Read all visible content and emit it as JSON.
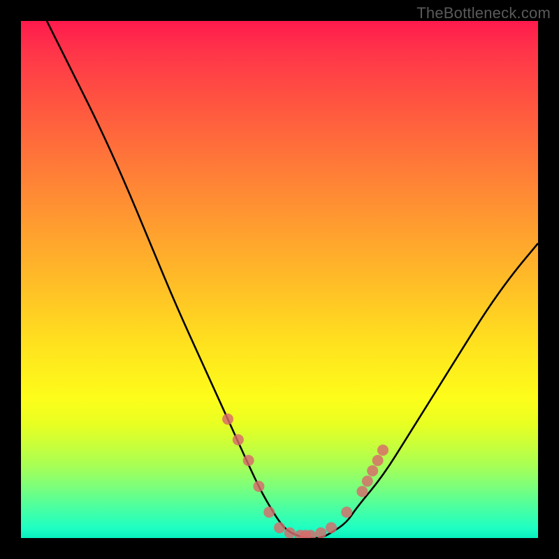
{
  "watermark": {
    "text": "TheBottleneck.com"
  },
  "colors": {
    "background": "#000000",
    "curve_stroke": "#000000",
    "marker_fill": "#d86a6a",
    "bottom_accent": "#08f0c0"
  },
  "chart_data": {
    "type": "line",
    "title": "",
    "xlabel": "",
    "ylabel": "",
    "xlim": [
      0,
      100
    ],
    "ylim": [
      0,
      100
    ],
    "grid": false,
    "legend": false,
    "series": [
      {
        "name": "bottleneck-curve",
        "x": [
          5,
          10,
          15,
          20,
          25,
          30,
          35,
          40,
          45,
          47,
          50,
          52,
          55,
          58,
          60,
          63,
          65,
          70,
          75,
          80,
          85,
          90,
          95,
          100
        ],
        "y": [
          100,
          90,
          80,
          69,
          57,
          45,
          34,
          23,
          12,
          8,
          3,
          1,
          0,
          0,
          1,
          3,
          6,
          12,
          20,
          28,
          36,
          44,
          51,
          57
        ]
      }
    ],
    "markers": {
      "name": "highlight-dots",
      "x": [
        40,
        42,
        44,
        46,
        48,
        50,
        52,
        54,
        55,
        56,
        58,
        60,
        63,
        66,
        67,
        68,
        69,
        70
      ],
      "y": [
        23,
        19,
        15,
        10,
        5,
        2,
        1,
        0.5,
        0.5,
        0.5,
        1,
        2,
        5,
        9,
        11,
        13,
        15,
        17
      ]
    }
  }
}
